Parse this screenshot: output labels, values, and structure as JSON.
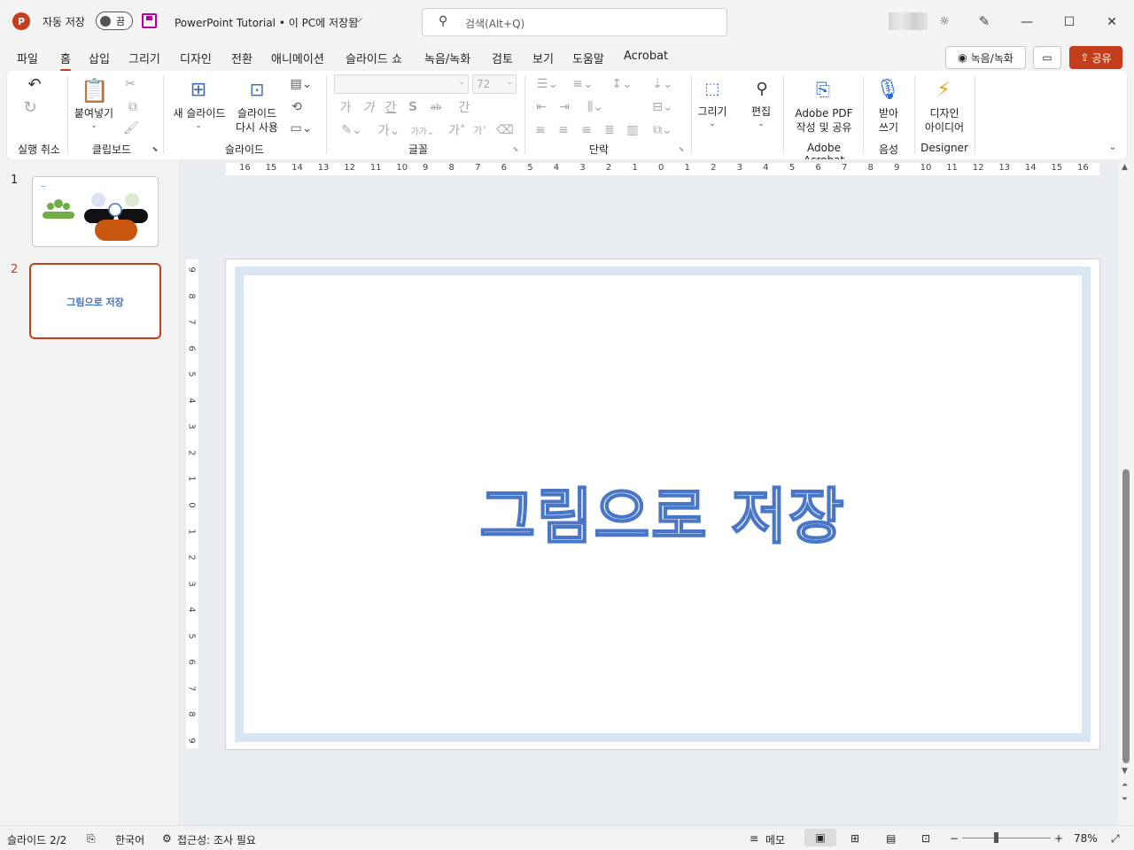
{
  "titlebar": {
    "app_icon_letter": "P",
    "autosave_label": "자동 저장",
    "autosave_state": "끔",
    "document_title": "PowerPoint Tutorial • 이 PC에 저장됨",
    "search_placeholder": "검색(Alt+Q)"
  },
  "tabs": [
    "파일",
    "홈",
    "삽입",
    "그리기",
    "디자인",
    "전환",
    "애니메이션",
    "슬라이드 쇼",
    "녹음/녹화",
    "검토",
    "보기",
    "도움말",
    "Acrobat"
  ],
  "active_tab": "홈",
  "top_right": {
    "record_label": "녹음/녹화",
    "share_label": "공유"
  },
  "ribbon": {
    "groups": {
      "undo": "실행 취소",
      "clipboard": "클립보드",
      "slides": "슬라이드",
      "font": "글꼴",
      "paragraph": "단락",
      "acrobat": "Adobe Acrobat",
      "voice": "음성",
      "designer": "Designer"
    },
    "paste_label": "붙여넣기",
    "new_slide_label": "새 슬라이드",
    "reuse_slides_line1": "슬라이드",
    "reuse_slides_line2": "다시 사용",
    "font_size": "72",
    "font_buttons": [
      "가",
      "가",
      "간",
      "S",
      "ab",
      "간"
    ],
    "draw_label": "그리기",
    "edit_label": "편집",
    "adobe_line1": "Adobe PDF",
    "adobe_line2": "작성 및 공유",
    "dictate_line1": "받아",
    "dictate_line2": "쓰기",
    "designer_line1": "디자인",
    "designer_line2": "아이디어"
  },
  "ruler": {
    "horizontal": [
      "16",
      "15",
      "14",
      "13",
      "12",
      "11",
      "10",
      "9",
      "8",
      "7",
      "6",
      "5",
      "4",
      "3",
      "2",
      "1",
      "0",
      "1",
      "2",
      "3",
      "4",
      "5",
      "6",
      "7",
      "8",
      "9",
      "10",
      "11",
      "12",
      "13",
      "14",
      "15",
      "16"
    ],
    "vertical": [
      "9",
      "8",
      "7",
      "6",
      "5",
      "4",
      "3",
      "2",
      "1",
      "0",
      "1",
      "2",
      "3",
      "4",
      "5",
      "6",
      "7",
      "8",
      "9"
    ]
  },
  "thumbnails": [
    {
      "number": "1"
    },
    {
      "number": "2",
      "text": "그림으로 저장"
    }
  ],
  "slide": {
    "title": "그림으로 저장"
  },
  "status": {
    "slide_counter": "슬라이드 2/2",
    "language": "한국어",
    "accessibility": "접근성: 조사 필요",
    "notes": "메모",
    "zoom": "78%"
  },
  "colors": {
    "accent": "#c43e1c",
    "slide_text": "#4a76c8",
    "slide_border": "#dbe6f3"
  }
}
